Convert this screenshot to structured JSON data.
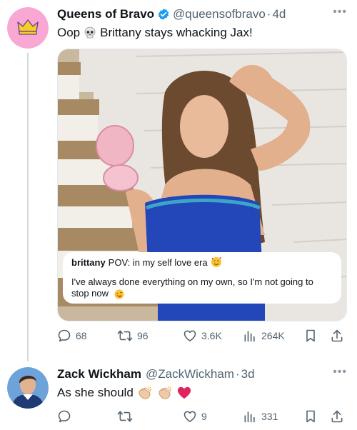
{
  "tweet1": {
    "name": "Queens of Bravo",
    "handle": "@queensofbravo",
    "separator": "·",
    "time": "4d",
    "text_before": "Oop",
    "text_after": "Brittany stays whacking Jax!",
    "emoji": "skull-emoji",
    "caption": {
      "pov_user": "brittany",
      "pov_text": "POV: in my self love era",
      "quote": "I've always done everything on my own, so I'm not going to stop now"
    },
    "actions": {
      "replies": "68",
      "retweets": "96",
      "likes": "3.6K",
      "views": "264K"
    }
  },
  "tweet2": {
    "name": "Zack Wickham",
    "handle": "@ZackWickham",
    "separator": "·",
    "time": "3d",
    "text": "As she should",
    "emojis": [
      "clapping-hands-emoji",
      "clapping-hands-emoji",
      "red-heart-emoji"
    ],
    "actions": {
      "replies": "",
      "retweets": "",
      "likes": "9",
      "views": "331"
    }
  },
  "colors": {
    "accent": "#1d9bf0",
    "muted": "#536471",
    "avatar_bg": "#f9a8d4",
    "crown": "#f5d020"
  }
}
